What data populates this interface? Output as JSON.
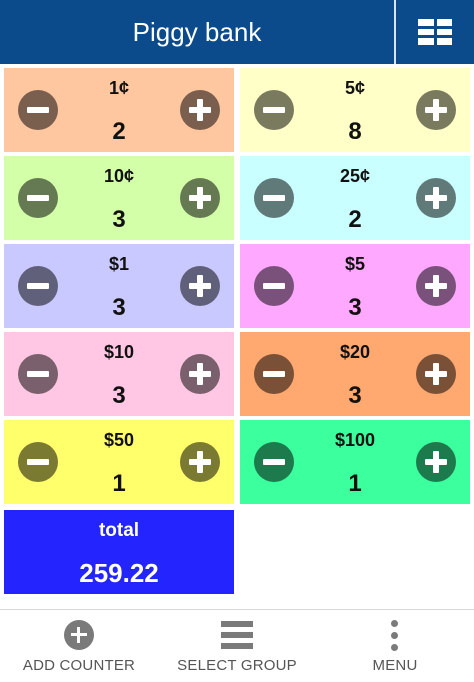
{
  "header": {
    "title": "Piggy bank",
    "grid_icon": "grid-icon"
  },
  "counters": [
    {
      "label": "1¢",
      "count": "2",
      "bg": "#ffc79f",
      "btn": "#7a5e4e"
    },
    {
      "label": "5¢",
      "count": "8",
      "bg": "#ffffc7",
      "btn": "#7a7a5f"
    },
    {
      "label": "10¢",
      "count": "3",
      "bg": "#d2ffa8",
      "btn": "#657a52"
    },
    {
      "label": "25¢",
      "count": "2",
      "bg": "#c9ffff",
      "btn": "#607a7a"
    },
    {
      "label": "$1",
      "count": "3",
      "bg": "#c9c9ff",
      "btn": "#60607a"
    },
    {
      "label": "$5",
      "count": "3",
      "bg": "#ffa8ff",
      "btn": "#7a517a"
    },
    {
      "label": "$10",
      "count": "3",
      "bg": "#ffc7e3",
      "btn": "#7a5f6d"
    },
    {
      "label": "$20",
      "count": "3",
      "bg": "#ffa870",
      "btn": "#7a5036"
    },
    {
      "label": "$50",
      "count": "1",
      "bg": "#ffff6b",
      "btn": "#7a7a33"
    },
    {
      "label": "$100",
      "count": "1",
      "bg": "#3cff9e",
      "btn": "#1d7a4c"
    }
  ],
  "total": {
    "label": "total",
    "value": "259.22",
    "bg": "#2424ff"
  },
  "bottom_nav": {
    "add_counter": "ADD COUNTER",
    "select_group": "SELECT GROUP",
    "menu": "MENU"
  }
}
